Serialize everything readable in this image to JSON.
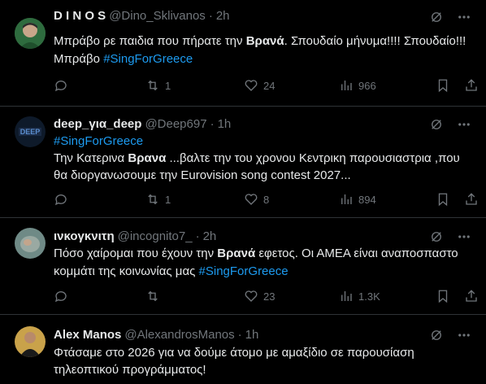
{
  "tweets": [
    {
      "name": "D I N O S",
      "handle": "@Dino_Sklivanos",
      "time": "2h",
      "line1": [
        {
          "t": "Μπράβο ρε παιδια που πήρατε την "
        },
        {
          "t": "Βρανά",
          "hl": true
        },
        {
          "t": ". Σπουδαίο μήνυμα!!!! Σπουδαίο!!!"
        }
      ],
      "line2": [
        {
          "t": "Μπράβο "
        },
        {
          "t": "#SingForGreece",
          "tag": true
        }
      ],
      "line3": [],
      "replies": "",
      "retweets": "1",
      "likes": "24",
      "views": "966"
    },
    {
      "name": "deep_για_deep",
      "handle": "@Deep697",
      "time": "1h",
      "line1": [
        {
          "t": "#SingForGreece",
          "tag": true
        }
      ],
      "line2": [
        {
          "t": "Την Κατερινα "
        },
        {
          "t": "Βρανα",
          "hl": true
        },
        {
          "t": " ...βαλτε την του χρονου  Κεντρικη παρουσιαστρια ,που"
        }
      ],
      "line3": [
        {
          "t": "θα διοργανωσουμε την Eurovision song contest 2027..."
        }
      ],
      "replies": "",
      "retweets": "1",
      "likes": "8",
      "views": "894"
    },
    {
      "name": "ινκογκνιτη",
      "handle": "@incognito7_",
      "time": "2h",
      "line1": [
        {
          "t": "Πόσο χαίρομαι που έχουν την "
        },
        {
          "t": "Βρανά",
          "hl": true
        },
        {
          "t": " εφετος. Οι ΑΜΕΑ είναι αναποσπαστο"
        }
      ],
      "line2": [
        {
          "t": "κομμάτι της κοινωνίας μας "
        },
        {
          "t": "#SingForGreece",
          "tag": true
        }
      ],
      "line3": [],
      "replies": "",
      "retweets": "",
      "likes": "23",
      "views": "1.3K"
    },
    {
      "name": "Alex Manos",
      "handle": "@AlexandrosManos",
      "time": "1h",
      "line1": [
        {
          "t": "Φτάσαμε στο 2026 για να δούμε άτομο με αμαξίδιο σε παρουσίαση"
        }
      ],
      "line2": [
        {
          "t": "τηλεοπτικού προγράμματος!"
        }
      ],
      "line3": [],
      "replies": "",
      "retweets": "",
      "likes": "",
      "views": ""
    }
  ],
  "colors": {
    "background": "#000000",
    "text": "#e7e9ea",
    "muted": "#71767b",
    "link": "#1d9bf0",
    "border": "#2f3336"
  }
}
